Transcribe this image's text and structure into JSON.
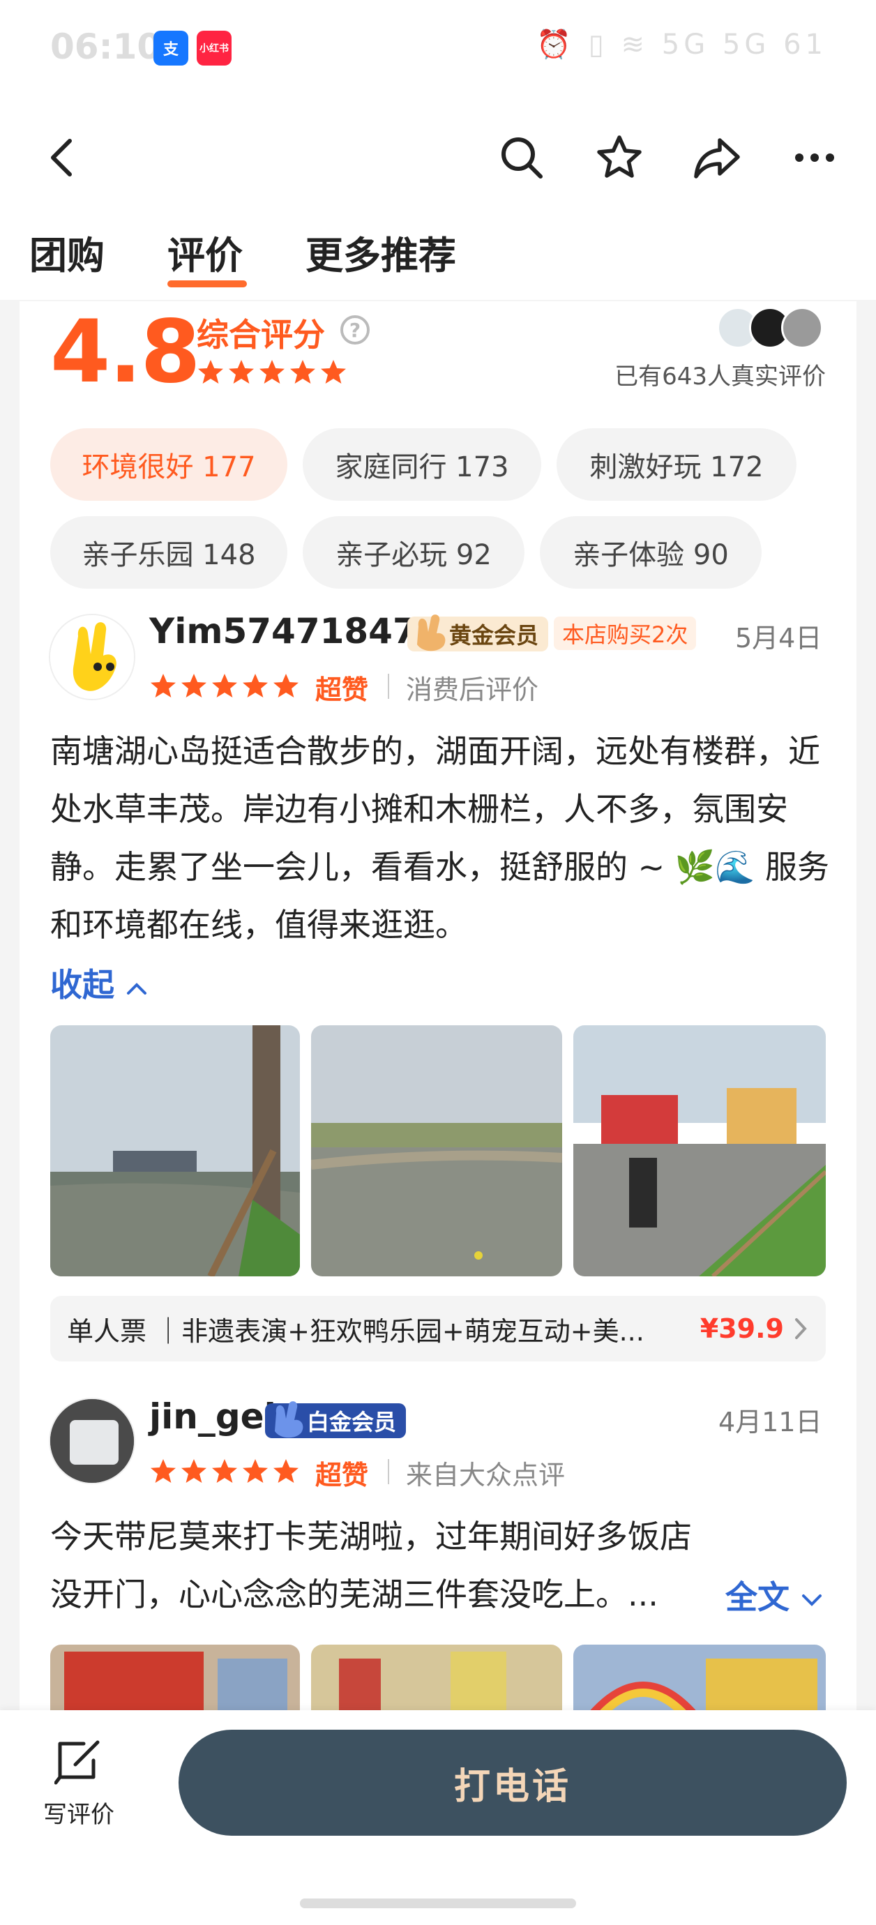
{
  "status_bar": {
    "time": "06:10",
    "app1": "支",
    "app2": "小红书",
    "right_icons": "⏰ ▯ ≋ 5G 5G 61"
  },
  "tabs": [
    {
      "label": "团购"
    },
    {
      "label": "评价"
    },
    {
      "label": "更多推荐"
    }
  ],
  "rating": {
    "score": "4.8",
    "label": "综合评分",
    "review_count": "已有643人真实评价"
  },
  "tags": [
    {
      "label": "环境很好 177"
    },
    {
      "label": "家庭同行 173"
    },
    {
      "label": "刺激好玩 172"
    },
    {
      "label": "亲子乐园 148"
    },
    {
      "label": "亲子必玩 92"
    },
    {
      "label": "亲子体验 90"
    }
  ],
  "reviews": [
    {
      "username": "Yim574718471",
      "member_badge": "黄金会员",
      "buy_badge": "本店购买2次",
      "date": "5月4日",
      "rating_word": "超赞",
      "source": "消费后评价",
      "text": "南塘湖心岛挺适合散步的，湖面开阔，远处有楼群，近处水草丰茂。岸边有小摊和木栅栏，人不多，氛围安静。走累了坐一会儿，看看水，挺舒服的 ~ 🌿🌊 服务和环境都在线，值得来逛逛。",
      "collapse": "收起",
      "ticket": "单人票 ｜非遗表演+狂欢鸭乐园+萌宠互动+美...",
      "price": "¥39.9"
    },
    {
      "username": "jin_gel",
      "member_badge": "白金会员",
      "date": "4月11日",
      "rating_word": "超赞",
      "source": "来自大众点评",
      "text": "今天带尼莫来打卡芜湖啦，过年期间好多饭店没开门，心心念念的芜湖三件套没吃上。...",
      "expand": "全文"
    }
  ],
  "bottom": {
    "write_review": "写评价",
    "call": "打电话"
  },
  "colors": {
    "accent": "#ff5a1f",
    "link": "#2f67d2",
    "call_bg": "#3d5160",
    "call_text": "#f4d6b8"
  }
}
